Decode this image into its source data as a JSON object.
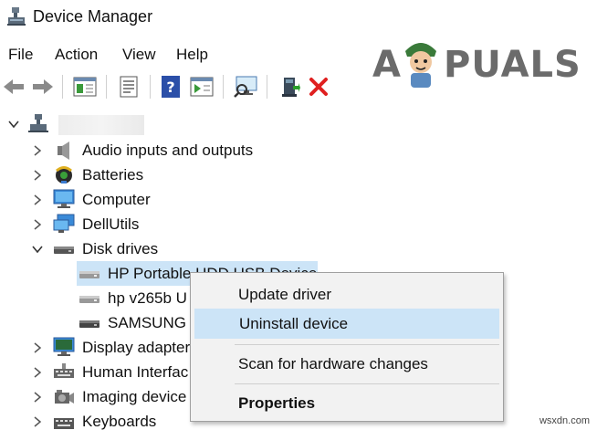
{
  "window": {
    "title": "Device Manager"
  },
  "menu": [
    "File",
    "Action",
    "View",
    "Help"
  ],
  "toolbar": {
    "icons": [
      "back-arrow-icon",
      "forward-arrow-icon",
      "properties-pane-icon",
      "document-icon",
      "help-icon",
      "run-icon",
      "monitor-scan-icon",
      "add-driver-icon",
      "remove-device-icon"
    ]
  },
  "logo": {
    "text_a": "A",
    "text_rest": "PUALS"
  },
  "tree": {
    "root_name": "",
    "categories": [
      {
        "label": "Audio inputs and outputs",
        "icon": "speaker-icon",
        "expanded": false
      },
      {
        "label": "Batteries",
        "icon": "battery-icon",
        "expanded": false
      },
      {
        "label": "Computer",
        "icon": "computer-icon",
        "expanded": false
      },
      {
        "label": "DellUtils",
        "icon": "network-monitor-icon",
        "expanded": false
      },
      {
        "label": "Disk drives",
        "icon": "disk-drive-icon",
        "expanded": true
      },
      {
        "label": "Display adapter",
        "icon": "display-adapter-icon",
        "expanded": false
      },
      {
        "label": "Human Interfac",
        "icon": "hid-icon",
        "expanded": false
      },
      {
        "label": "Imaging device",
        "icon": "camera-icon",
        "expanded": false
      },
      {
        "label": "Keyboards",
        "icon": "keyboard-icon",
        "expanded": false
      }
    ],
    "disk_children": [
      {
        "label": "HP Portable HDD USB Device",
        "selected": true
      },
      {
        "label": "hp v265b U",
        "selected": false
      },
      {
        "label": "SAMSUNG S",
        "selected": false
      }
    ]
  },
  "context_menu": {
    "items": [
      "Update driver",
      "Uninstall device",
      "Scan for hardware changes",
      "Properties"
    ],
    "highlighted": "Uninstall device"
  },
  "watermark": "wsxdn.com",
  "colors": {
    "selection": "#cce4f7",
    "delete_red": "#e02020",
    "help_blue": "#2b4fa8"
  }
}
